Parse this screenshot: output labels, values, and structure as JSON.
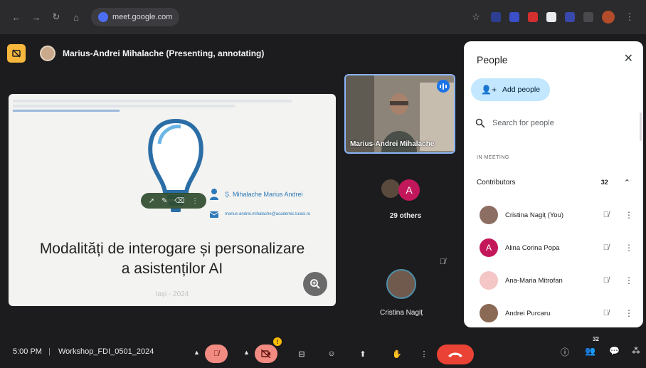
{
  "browser": {
    "url": "meet.google.com"
  },
  "presenter": {
    "label": "Marius-Andrei Mihalache (Presenting, annotating)"
  },
  "slide": {
    "author": "Ș. Mihalache Marius Andrei",
    "email": "marius-andrei.mihalache@academic.tuiasi.ro",
    "title_line1": "Modalități de interogare și personalizare",
    "title_line2": "a asistenților AI",
    "footer": "Iași - 2024"
  },
  "tiles": {
    "video_name": "Marius-Andrei Mihalache",
    "others_avatar_letter": "A",
    "others_label": "29 others",
    "self_name": "Cristina Nagiț"
  },
  "people_panel": {
    "title": "People",
    "add_people": "Add people",
    "search_placeholder": "Search for people",
    "section": "IN MEETING",
    "group_label": "Contributors",
    "group_count": "32",
    "people": [
      {
        "name": "Cristina Nagiț (You)",
        "avatar": "",
        "color": "#8d6e63"
      },
      {
        "name": "Alina Corina Popa",
        "avatar": "A",
        "color": "#c2185b"
      },
      {
        "name": "Ana-Maria Mitrofan",
        "avatar": "",
        "color": "#f4c6c6"
      },
      {
        "name": "Andrei Purcaru",
        "avatar": "",
        "color": "#8b6a55"
      }
    ]
  },
  "bottom": {
    "time": "5:00 PM",
    "meeting_name": "Workshop_FDI_0501_2024",
    "camera_badge": "!",
    "people_count": "32"
  },
  "colors": {
    "accent": "#8ab4f8",
    "add_people_bg": "#c2e7ff",
    "end_call": "#ea4335",
    "muted_ctrl": "#f28b82"
  }
}
